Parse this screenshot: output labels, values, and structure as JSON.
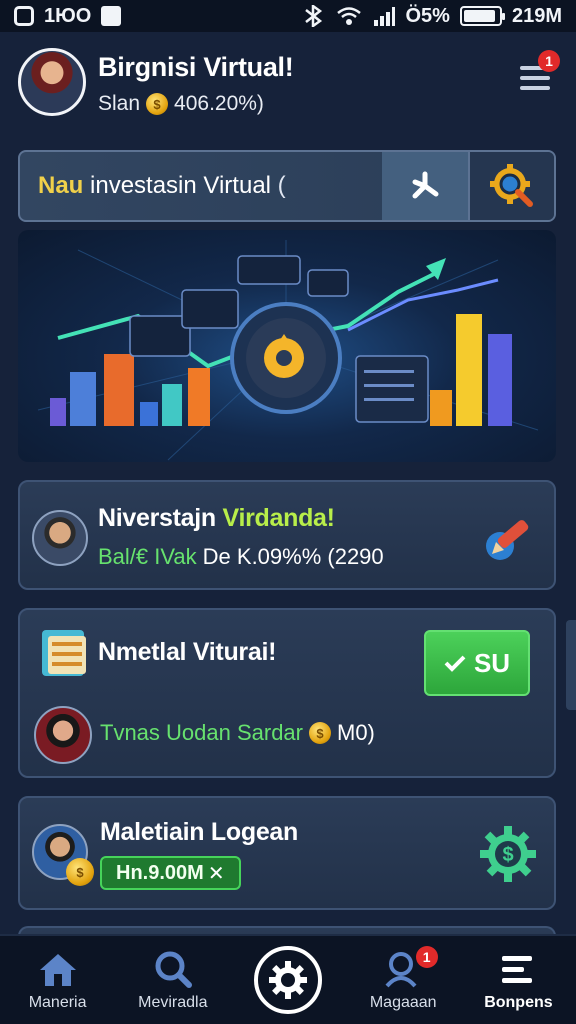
{
  "status_bar": {
    "left_text": "1ЮO",
    "battery_text": "Ö5%",
    "time": "219M"
  },
  "header": {
    "title": "Birgnisi Virtual!",
    "subtitle_label": "Slan",
    "subtitle_value": "406.20%)",
    "notification_count": "1"
  },
  "search": {
    "prefix": "Nau",
    "text": " investasin Virtual"
  },
  "cards": [
    {
      "title_white": "Niverstajn",
      "title_green": "Virdanda!",
      "sub_green": "Bal/€ IVak",
      "sub_rest": "De K.09%% (2290"
    },
    {
      "title": "Nmetlal Viturai!",
      "button_label": "SU",
      "sub_green": "Tvnas Uodan Sardar",
      "sub_value": "M0)"
    },
    {
      "title": "Maletiain Logean",
      "pill_text": "Hn.9.00M"
    }
  ],
  "nav": {
    "items": [
      "Maneria",
      "Meviradla",
      "",
      "Magaaan",
      "Bonpens"
    ],
    "badge": "1"
  },
  "colors": {
    "accent_yellow": "#f0d04a",
    "accent_green": "#46d45a",
    "bg": "#16223a"
  }
}
